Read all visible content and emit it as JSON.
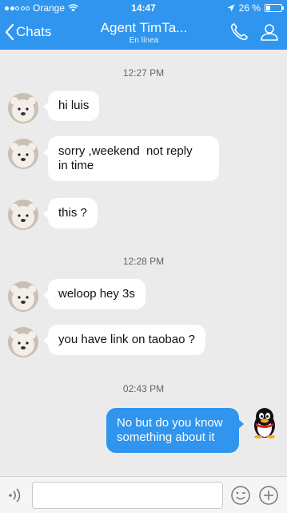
{
  "status_bar": {
    "carrier": "Orange",
    "time": "14:47",
    "battery": "26 %",
    "battery_level": 0.26
  },
  "header": {
    "back_label": "Chats",
    "title": "Agent TimTa...",
    "subtitle": "En línea"
  },
  "messages": [
    {
      "type": "time",
      "text": "12:27 PM"
    },
    {
      "type": "in",
      "lines": [
        "hi luis"
      ]
    },
    {
      "type": "in",
      "lines": [
        "sorry ,weekend  not reply",
        "in time"
      ]
    },
    {
      "type": "in",
      "lines": [
        "this ?"
      ]
    },
    {
      "type": "time",
      "text": "12:28 PM"
    },
    {
      "type": "in",
      "lines": [
        "weloop hey 3s"
      ]
    },
    {
      "type": "in",
      "lines": [
        "you have link on taobao ?"
      ]
    },
    {
      "type": "time",
      "text": "02:43 PM"
    },
    {
      "type": "out",
      "lines": [
        "No but do you know",
        "something about it"
      ]
    }
  ],
  "input": {
    "value": "",
    "placeholder": ""
  },
  "colors": {
    "accent": "#2f95ee",
    "background": "#ebebeb",
    "incoming_bubble": "#ffffff",
    "outgoing_bubble": "#2f95ee"
  },
  "icons": [
    "back-chevron-icon",
    "phone-icon",
    "user-icon",
    "voice-icon",
    "emoji-icon",
    "plus-icon",
    "wifi-icon",
    "location-arrow-icon",
    "battery-icon"
  ]
}
